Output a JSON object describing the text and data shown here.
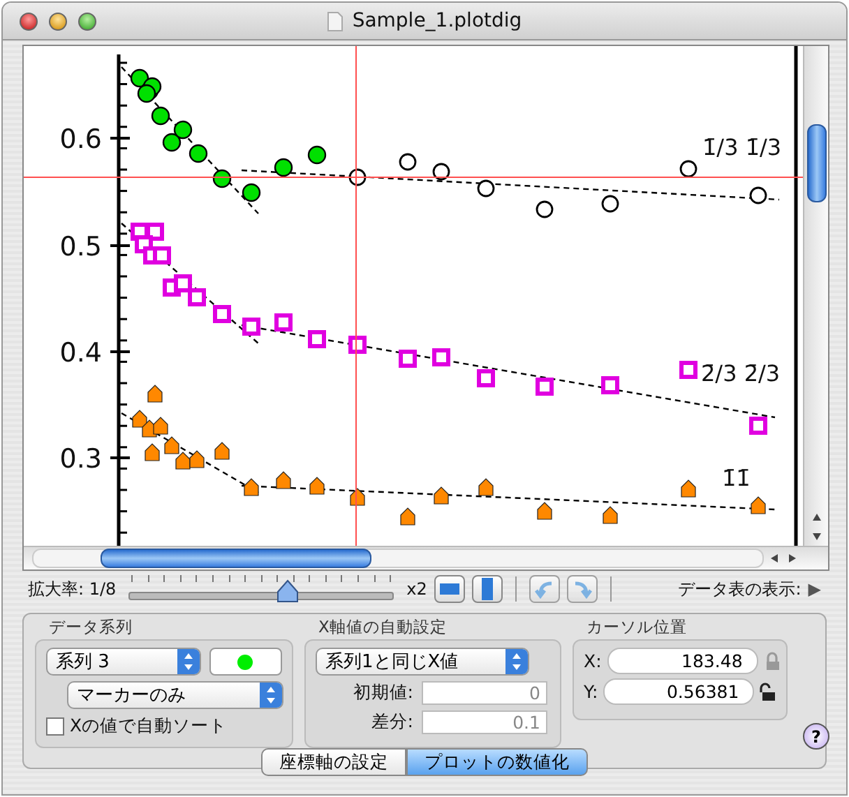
{
  "window": {
    "title": "Sample_1.plotdig"
  },
  "plot": {
    "yticks": [
      "0.6",
      "0.5",
      "0.4",
      "0.3"
    ],
    "curve_labels": [
      "1̄/3 1̄/3",
      "2̄/3 2̄/3",
      "1̄1̄"
    ]
  },
  "toolbar": {
    "zoom_label": "拡大率:",
    "zoom_min": "1/8",
    "zoom_max": "x2",
    "zoom": {
      "level": 0.6
    },
    "table_label": "データ表の表示:",
    "table_toggle": "▶"
  },
  "data_series": {
    "title": "データ系列",
    "series": "系列 3",
    "color": "#00ee00",
    "marker": "マーカーのみ",
    "auto_sort": {
      "label": "Xの値で自動ソート",
      "checked": false
    }
  },
  "x_auto": {
    "title": "X軸値の自動設定",
    "mode": "系列1と同じX値",
    "fields": [
      {
        "label": "初期値:",
        "value": "0",
        "disabled": true
      },
      {
        "label": "差分:",
        "value": "0.1",
        "disabled": true
      }
    ]
  },
  "cursor": {
    "title": "カーソル位置",
    "fields": [
      {
        "label": "X:",
        "value": "183.48",
        "locked": true
      },
      {
        "label": "Y:",
        "value": "0.56381",
        "locked": false
      }
    ]
  },
  "help": "?",
  "tabs": [
    {
      "label": "座標軸の設定",
      "selected": false
    },
    {
      "label": "プロットの数値化",
      "selected": true
    }
  ]
}
